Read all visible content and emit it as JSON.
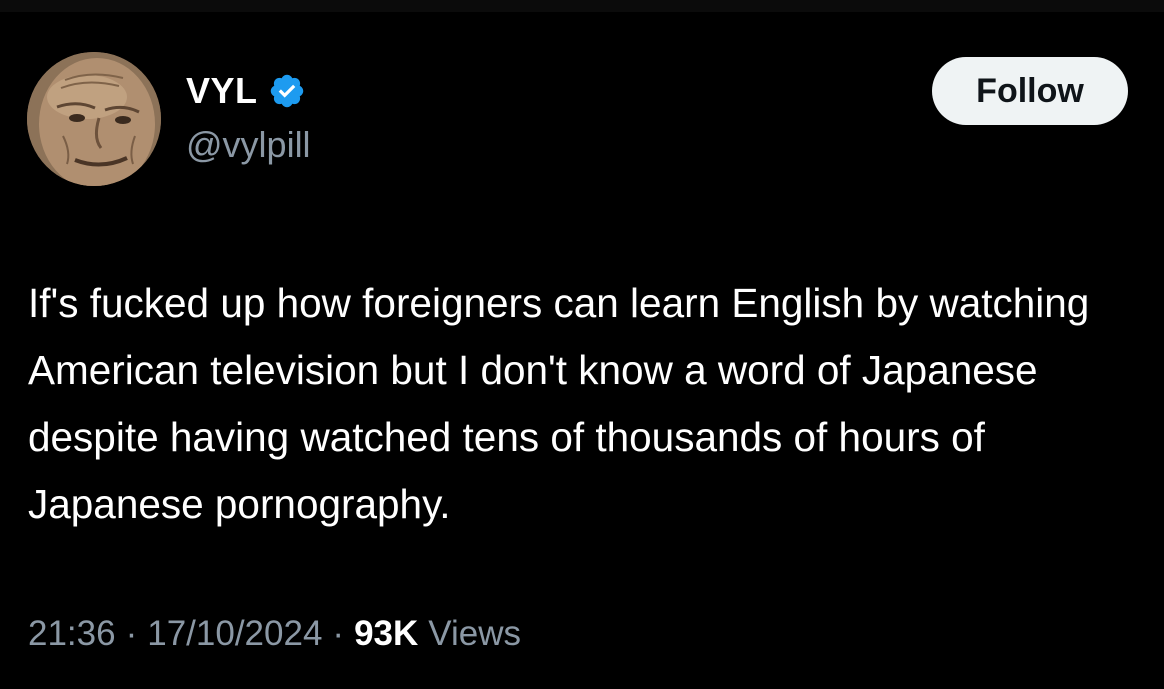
{
  "author": {
    "display_name": "VYL",
    "handle": "@vylpill",
    "verified": true,
    "avatar_icon": "elderly-face-avatar"
  },
  "actions": {
    "follow_label": "Follow"
  },
  "tweet": {
    "text": "If's fucked up how foreigners can learn English by watching American television but I don't know a word of Japanese despite having watched tens of thousands of hours of Japanese pornography."
  },
  "meta": {
    "time": "21:36",
    "separator": "·",
    "date": "17/10/2024",
    "views_count": "93K",
    "views_label": "Views"
  },
  "colors": {
    "background": "#000000",
    "text_primary": "#ffffff",
    "text_secondary": "#8b98a5",
    "verified_badge": "#1d9bf0",
    "follow_button_bg": "#eff3f4",
    "follow_button_text": "#0f1419"
  }
}
